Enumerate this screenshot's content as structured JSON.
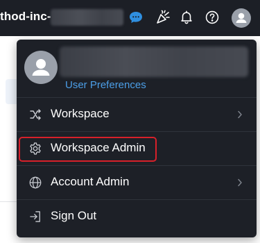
{
  "header": {
    "workspace_name": "thod-inc-",
    "icons": [
      "chat-bubble-icon",
      "announcement-icon",
      "bell-icon",
      "help-icon",
      "user-avatar-icon"
    ]
  },
  "menu": {
    "user_preferences_label": "User Preferences",
    "items": [
      {
        "label": "Workspace",
        "icon": "shuffle-icon",
        "has_submenu": true
      },
      {
        "label": "Workspace Admin",
        "icon": "gear-icon",
        "has_submenu": false,
        "highlighted": true
      },
      {
        "label": "Account Admin",
        "icon": "globe-icon",
        "has_submenu": true
      },
      {
        "label": "Sign Out",
        "icon": "sign-out-icon",
        "has_submenu": false
      }
    ]
  },
  "colors": {
    "topbar_bg": "#1c1f26",
    "menu_bg": "#1d2027",
    "link_blue": "#4c9fe8",
    "chat_icon_blue": "#2f8fe0",
    "highlight_red": "#d8202a",
    "avatar_gray": "#9aa0aa"
  }
}
